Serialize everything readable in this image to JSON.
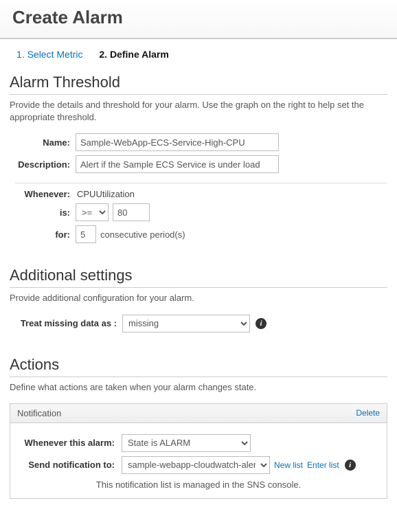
{
  "page_title": "Create Alarm",
  "steps": {
    "step1": "1. Select Metric",
    "step2": "2. Define Alarm"
  },
  "threshold": {
    "heading": "Alarm Threshold",
    "desc": "Provide the details and threshold for your alarm. Use the graph on the right to help set the appropriate threshold.",
    "name_label": "Name:",
    "name_value": "Sample-WebApp-ECS-Service-High-CPU",
    "desc_label": "Description:",
    "desc_value": "Alert if the Sample ECS Service is under load",
    "whenever_label": "Whenever:",
    "whenever_value": "CPUUtilization",
    "is_label": "is:",
    "is_op": ">=",
    "is_value": "80",
    "for_label": "for:",
    "for_value": "5",
    "for_suffix": "consecutive period(s)"
  },
  "additional": {
    "heading": "Additional settings",
    "desc": "Provide additional configuration for your alarm.",
    "missing_label": "Treat missing data as :",
    "missing_value": "missing"
  },
  "actions": {
    "heading": "Actions",
    "desc": "Define what actions are taken when your alarm changes state.",
    "panel_title": "Notification",
    "delete": "Delete",
    "whenever_label": "Whenever this alarm:",
    "whenever_value": "State is ALARM",
    "send_label": "Send notification to:",
    "send_value": "sample-webapp-cloudwatch-alerts",
    "new_list": "New list",
    "enter_list": "Enter list",
    "note": "This notification list is managed in the SNS console."
  }
}
